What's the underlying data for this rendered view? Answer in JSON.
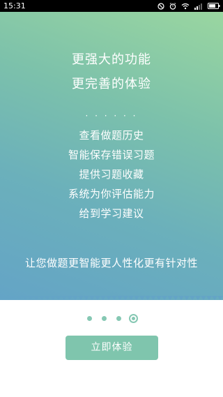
{
  "status_bar": {
    "time": "15:31",
    "icons": [
      "do-not-disturb-icon",
      "alarm-icon",
      "wifi-icon",
      "signal-icon",
      "battery-icon"
    ]
  },
  "hero": {
    "headline_line1": "更强大的功能",
    "headline_line2": "更完善的体验",
    "divider": "· · · · · ·",
    "features": [
      "查看做题历史",
      "智能保存错误习题",
      "提供习题收藏",
      "系统为你评估能力",
      "给到学习建议"
    ],
    "tagline": "让您做题更智能更人性化更有针对性",
    "gradient_colors": [
      "#9ad6a0",
      "#64a4c6"
    ]
  },
  "pager": {
    "page_count": 4,
    "current_page": 4,
    "accent_color": "#86c8b3"
  },
  "start_button": {
    "label": "立即体验",
    "color": "#7fc5ad"
  }
}
